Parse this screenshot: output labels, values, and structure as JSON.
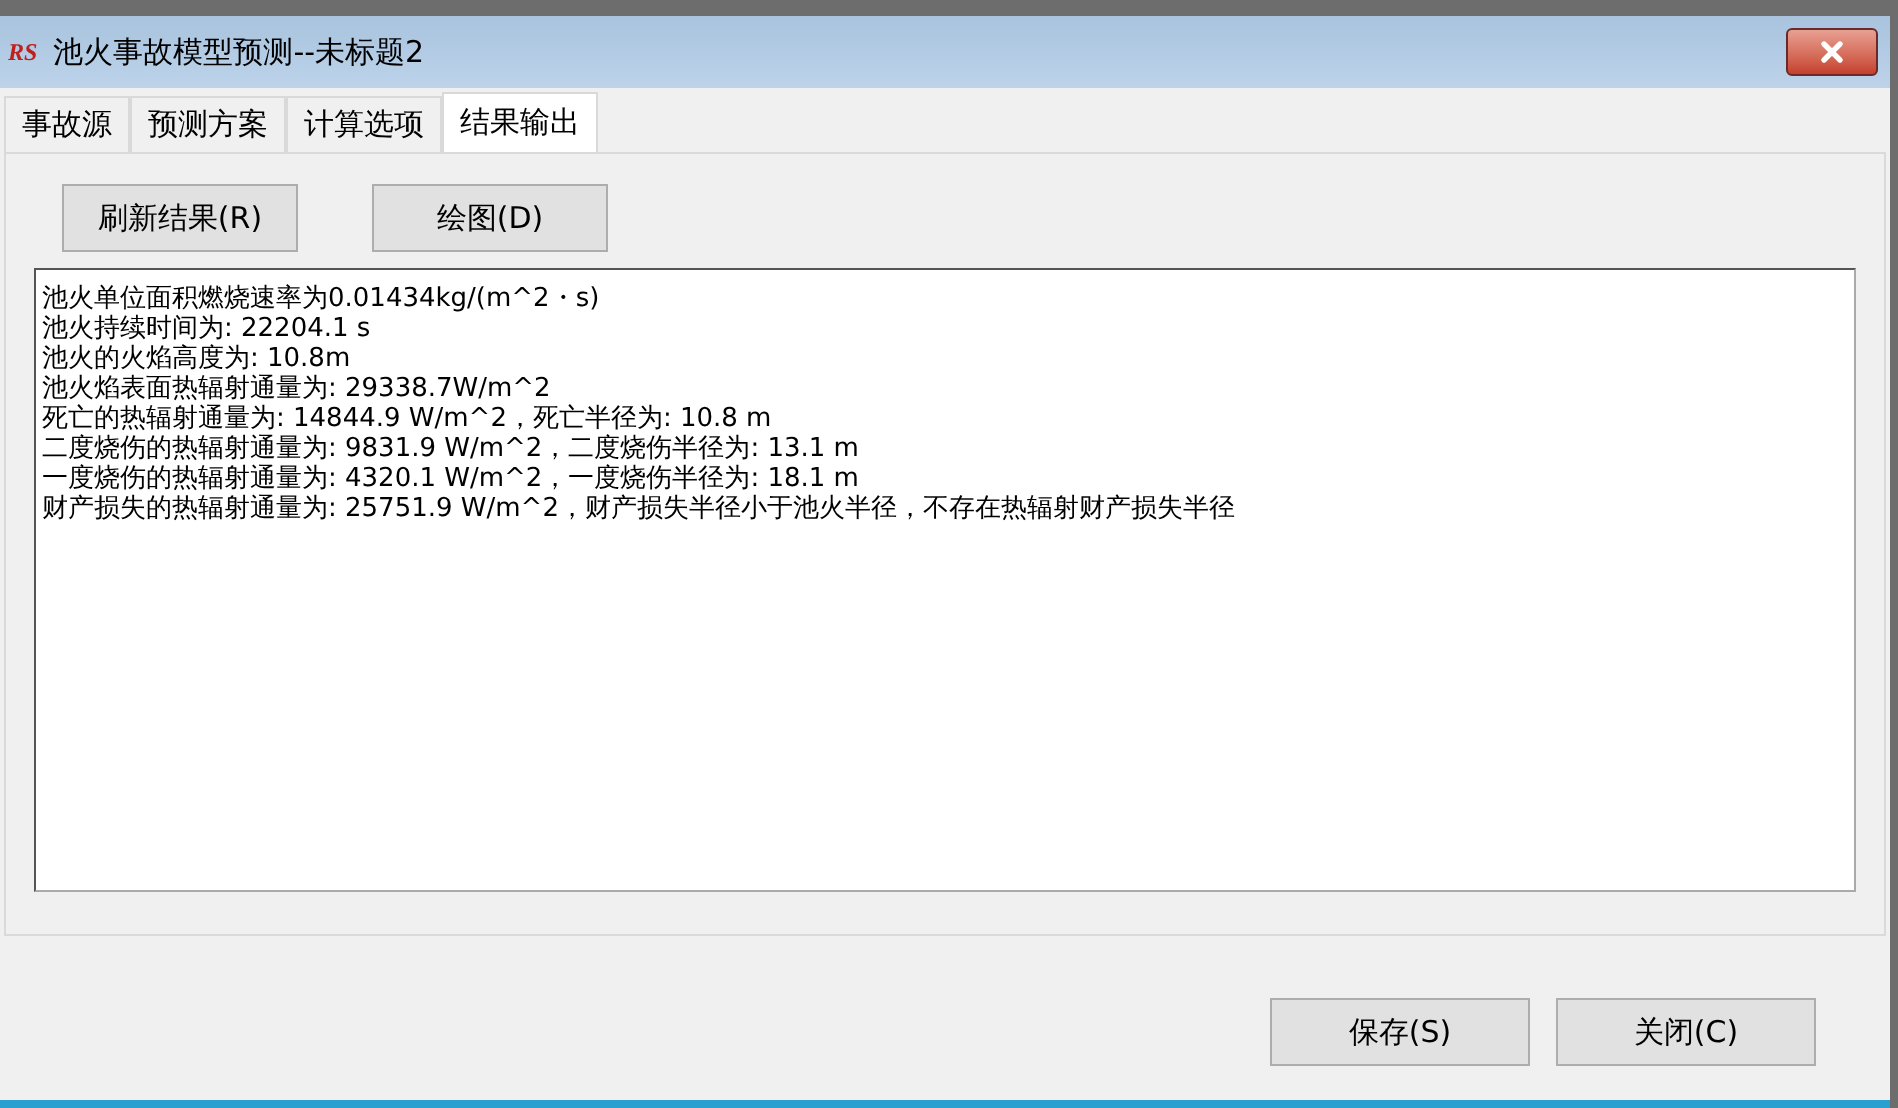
{
  "window": {
    "logo": "RS",
    "title": "池火事故模型预测--未标题2"
  },
  "tabs": [
    {
      "label": "事故源",
      "selected": false
    },
    {
      "label": "预测方案",
      "selected": false
    },
    {
      "label": "计算选项",
      "selected": false
    },
    {
      "label": "结果输出",
      "selected": true
    }
  ],
  "toolbar": [
    "刷新结果(R)",
    "绘图(D)"
  ],
  "results": [
    "池火单位面积燃烧速率为0.01434kg/(m^2・s)",
    "池火持续时间为: 22204.1 s",
    "池火的火焰高度为: 10.8m",
    "池火焰表面热辐射通量为: 29338.7W/m^2",
    "死亡的热辐射通量为: 14844.9 W/m^2，死亡半径为: 10.8 m",
    "二度烧伤的热辐射通量为: 9831.9 W/m^2，二度烧伤半径为: 13.1 m",
    "一度烧伤的热辐射通量为: 4320.1 W/m^2，一度烧伤半径为: 18.1 m",
    "财产损失的热辐射通量为: 25751.9 W/m^2，财产损失半径小于池火半径，不存在热辐射财产损失半径"
  ],
  "buttons": [
    "保存(S)",
    "关闭(C)"
  ]
}
